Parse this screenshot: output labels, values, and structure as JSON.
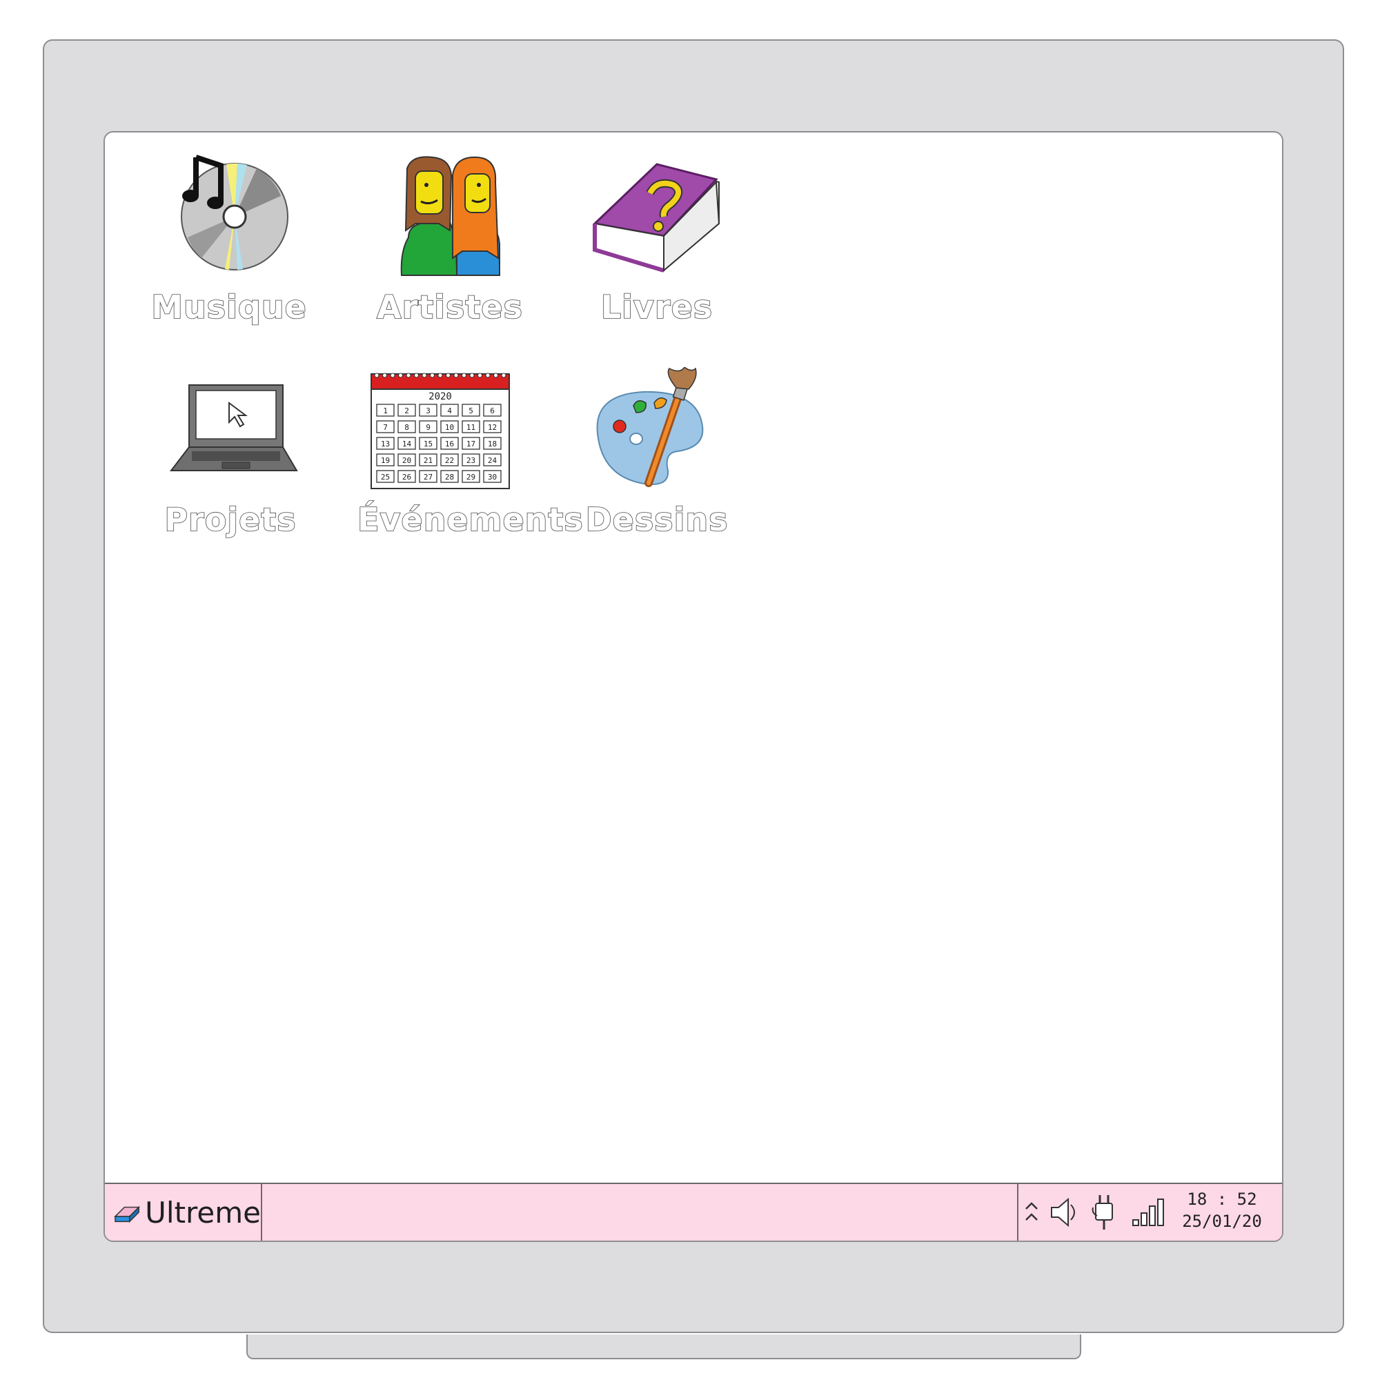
{
  "desktop": {
    "icons": [
      {
        "label": "Musique"
      },
      {
        "label": "Artistes"
      },
      {
        "label": "Livres"
      },
      {
        "label": "Projets"
      },
      {
        "label": "Événements"
      },
      {
        "label": "Dessins"
      }
    ],
    "calendar_year": "2020",
    "calendar_days": [
      "1",
      "2",
      "3",
      "4",
      "5",
      "6",
      "7",
      "8",
      "9",
      "10",
      "11",
      "12",
      "13",
      "14",
      "15",
      "16",
      "17",
      "18",
      "19",
      "20",
      "21",
      "22",
      "23",
      "24",
      "25",
      "26",
      "27",
      "28",
      "29",
      "30"
    ]
  },
  "taskbar": {
    "start_label": "Ultreme",
    "clock_time": "18 : 52",
    "clock_date": "25/01/20",
    "background_color": "#fdd8e6"
  }
}
